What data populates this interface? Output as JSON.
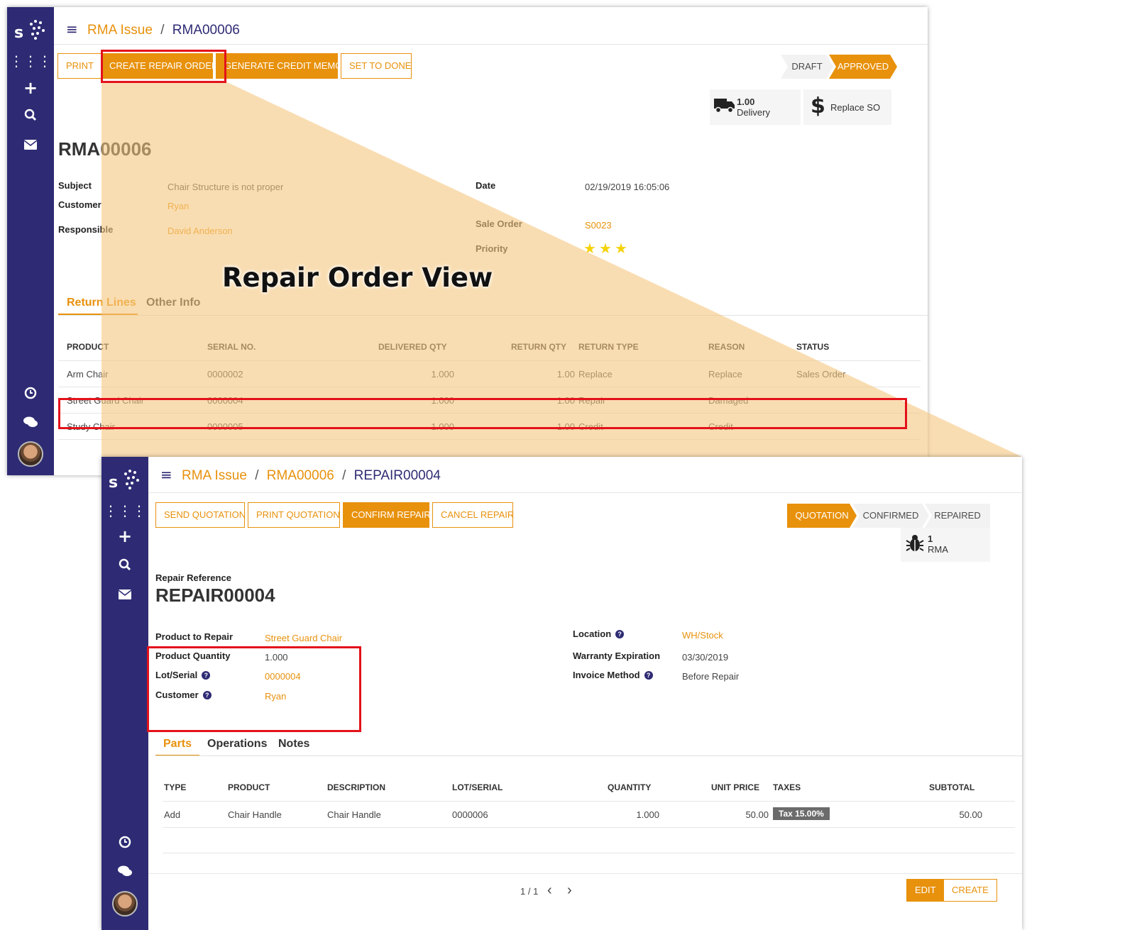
{
  "rma_window": {
    "breadcrumb": {
      "parent": "RMA Issue",
      "separator": "/",
      "current": "RMA00006"
    },
    "buttons": {
      "print": "PRINT",
      "create_repair": "CREATE REPAIR ORDER",
      "credit_memo": "GENERATE CREDIT MEMO",
      "set_done": "SET TO DONE"
    },
    "statuses": {
      "draft": "DRAFT",
      "approved": "APPROVED"
    },
    "stat_delivery": {
      "value": "1.00",
      "label": "Delivery"
    },
    "stat_replace": {
      "label": "Replace SO"
    },
    "title": "RMA00006",
    "fields": {
      "subject_label": "Subject",
      "subject_value": "Chair Structure is not proper",
      "customer_label": "Customer",
      "customer_value": "Ryan",
      "responsible_label": "Responsible",
      "responsible_value": "David Anderson",
      "date_label": "Date",
      "date_value": "02/19/2019 16:05:06",
      "sale_order_label": "Sale Order",
      "sale_order_value": "S0023",
      "priority_label": "Priority",
      "priority_stars": 3
    },
    "tabs": {
      "return_lines": "Return Lines",
      "other_info": "Other Info"
    },
    "table": {
      "headers": [
        "PRODUCT",
        "SERIAL NO.",
        "DELIVERED QTY",
        "RETURN QTY",
        "RETURN TYPE",
        "REASON",
        "STATUS"
      ],
      "rows": [
        [
          "Arm Chair",
          "0000002",
          "1.000",
          "1.00",
          "Replace",
          "Replace",
          "Sales Order"
        ],
        [
          "Street Guard Chair",
          "0000004",
          "1.000",
          "1.00",
          "Repair",
          "Damaged",
          ""
        ],
        [
          "Study Chair",
          "0000005",
          "1.000",
          "1.00",
          "Credit",
          "Credit",
          ""
        ]
      ]
    }
  },
  "callout": "Repair Order View",
  "repair_window": {
    "breadcrumb": {
      "root": "RMA Issue",
      "parent": "RMA00006",
      "separator": "/",
      "current": "REPAIR00004"
    },
    "buttons": {
      "send_quotation": "SEND QUOTATION",
      "print_quotation": "PRINT QUOTATION",
      "confirm_repair": "CONFIRM REPAIR",
      "cancel_repair": "CANCEL REPAIR"
    },
    "statuses": {
      "quotation": "QUOTATION",
      "confirmed": "CONFIRMED",
      "repaired": "REPAIRED"
    },
    "stat_rma": {
      "value": "1",
      "label": "RMA"
    },
    "ref_label": "Repair Reference",
    "title": "REPAIR00004",
    "fields": {
      "product_label": "Product to Repair",
      "product_value": "Street Guard Chair",
      "qty_label": "Product Quantity",
      "qty_value": "1.000",
      "lot_label": "Lot/Serial",
      "lot_value": "0000004",
      "customer_label": "Customer",
      "customer_value": "Ryan",
      "location_label": "Location",
      "location_value": "WH/Stock",
      "warranty_label": "Warranty Expiration",
      "warranty_value": "03/30/2019",
      "invoice_label": "Invoice Method",
      "invoice_value": "Before Repair"
    },
    "help_glyph": "?",
    "tabs": {
      "parts": "Parts",
      "operations": "Operations",
      "notes": "Notes"
    },
    "table": {
      "headers": [
        "TYPE",
        "PRODUCT",
        "DESCRIPTION",
        "LOT/SERIAL",
        "QUANTITY",
        "UNIT PRICE",
        "TAXES",
        "SUBTOTAL"
      ],
      "row": {
        "type": "Add",
        "product": "Chair Handle",
        "description": "Chair Handle",
        "lot": "0000006",
        "quantity": "1.000",
        "unit_price": "50.00",
        "tax": "Tax 15.00%",
        "subtotal": "50.00"
      }
    },
    "pager": {
      "text": "1 / 1",
      "prev": "‹",
      "next": "›"
    },
    "bottom_buttons": {
      "edit": "EDIT",
      "create": "CREATE"
    }
  },
  "colors": {
    "accent": "#e8910c",
    "sidebar": "#2e2b74",
    "highlight": "#e3121a",
    "overlay": "#f5c77e"
  },
  "icons": {
    "menu": "hamburger-icon",
    "apps": "grid-icon",
    "plus": "plus-icon",
    "search": "search-icon",
    "mail": "envelope-icon",
    "clock": "clock-icon",
    "chat": "chat-icon",
    "truck": "truck-icon",
    "dollar": "dollar-icon",
    "bug": "bug-icon",
    "star": "star-icon"
  }
}
